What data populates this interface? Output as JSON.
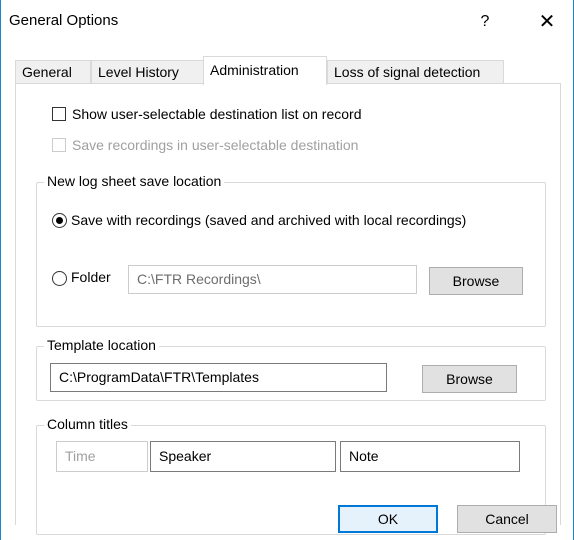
{
  "window": {
    "title": "General Options",
    "help_label": "?",
    "close_label": "✕"
  },
  "tabs": [
    {
      "label": "General"
    },
    {
      "label": "Level History"
    },
    {
      "label": "Administration",
      "active": true
    },
    {
      "label": "Loss of signal detection"
    }
  ],
  "options": {
    "show_destination_list": {
      "label": "Show user-selectable destination list on record",
      "checked": false
    },
    "save_in_destination": {
      "label": "Save recordings in user-selectable destination",
      "checked": false,
      "disabled": true
    }
  },
  "log_sheet": {
    "group_title": "New log sheet save location",
    "save_with_recordings_label": "Save with recordings (saved and archived with local recordings)",
    "folder_label": "Folder",
    "folder_value": "C:\\FTR Recordings\\",
    "browse_label": "Browse",
    "selected": "save_with_recordings"
  },
  "template": {
    "group_title": "Template location",
    "path_value": "C:\\ProgramData\\FTR\\Templates",
    "browse_label": "Browse"
  },
  "columns": {
    "group_title": "Column titles",
    "cells": [
      "Time",
      "Speaker",
      "Note"
    ]
  },
  "footer": {
    "ok_label": "OK",
    "cancel_label": "Cancel"
  },
  "colors": {
    "window_border": "#1e86c8",
    "default_button_border": "#0078d7",
    "disabled_text": "#a0a0a0"
  }
}
